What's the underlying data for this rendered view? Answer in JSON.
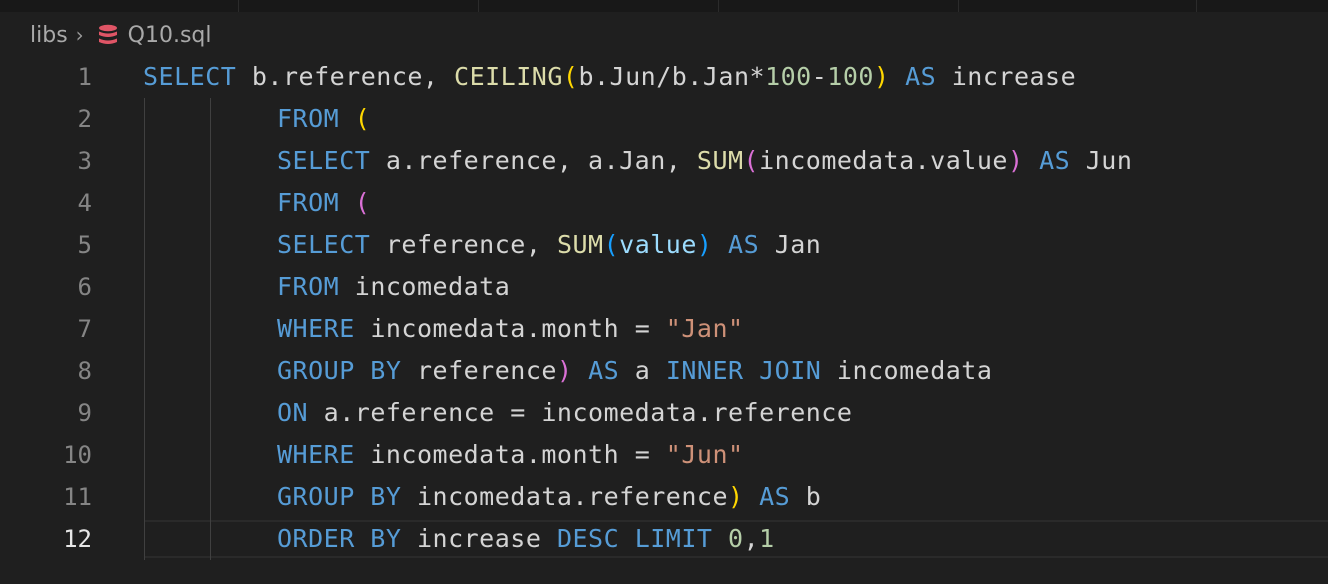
{
  "breadcrumb": {
    "folder": "libs",
    "separator": "›",
    "file_icon": "database-icon",
    "file_name": "Q10.sql"
  },
  "colors": {
    "background": "#1f1f1f",
    "keyword": "#569cd6",
    "function": "#dcdcaa",
    "number": "#b5cea8",
    "string": "#ce9178",
    "bracket_1": "#ffd700",
    "bracket_2": "#da70d6",
    "bracket_3": "#179fff",
    "icon": "#e05566"
  },
  "editor": {
    "current_line": 12,
    "lines": [
      {
        "n": "1",
        "indent": false,
        "tokens": [
          {
            "t": "SELECT",
            "c": "kw"
          },
          {
            "t": " b.reference, ",
            "c": "id"
          },
          {
            "t": "CEILING",
            "c": "fn"
          },
          {
            "t": "(",
            "c": "p1"
          },
          {
            "t": "b.Jun/b.Jan*",
            "c": "id"
          },
          {
            "t": "100",
            "c": "num"
          },
          {
            "t": "-",
            "c": "id"
          },
          {
            "t": "100",
            "c": "num"
          },
          {
            "t": ")",
            "c": "p1"
          },
          {
            "t": " ",
            "c": "id"
          },
          {
            "t": "AS",
            "c": "kw"
          },
          {
            "t": " increase",
            "c": "id"
          }
        ]
      },
      {
        "n": "2",
        "indent": true,
        "tokens": [
          {
            "t": "FROM",
            "c": "kw"
          },
          {
            "t": " ",
            "c": "id"
          },
          {
            "t": "(",
            "c": "p1"
          }
        ]
      },
      {
        "n": "3",
        "indent": true,
        "tokens": [
          {
            "t": "SELECT",
            "c": "kw"
          },
          {
            "t": " a.reference, a.Jan, ",
            "c": "id"
          },
          {
            "t": "SUM",
            "c": "fn"
          },
          {
            "t": "(",
            "c": "p2"
          },
          {
            "t": "incomedata.value",
            "c": "id"
          },
          {
            "t": ")",
            "c": "p2"
          },
          {
            "t": " ",
            "c": "id"
          },
          {
            "t": "AS",
            "c": "kw"
          },
          {
            "t": " Jun",
            "c": "id"
          }
        ]
      },
      {
        "n": "4",
        "indent": true,
        "tokens": [
          {
            "t": "FROM",
            "c": "kw"
          },
          {
            "t": " ",
            "c": "id"
          },
          {
            "t": "(",
            "c": "p2"
          }
        ]
      },
      {
        "n": "5",
        "indent": true,
        "tokens": [
          {
            "t": "SELECT",
            "c": "kw"
          },
          {
            "t": " reference, ",
            "c": "id"
          },
          {
            "t": "SUM",
            "c": "fn"
          },
          {
            "t": "(",
            "c": "p3"
          },
          {
            "t": "value",
            "c": "col"
          },
          {
            "t": ")",
            "c": "p3"
          },
          {
            "t": " ",
            "c": "id"
          },
          {
            "t": "AS",
            "c": "kw"
          },
          {
            "t": " Jan",
            "c": "id"
          }
        ]
      },
      {
        "n": "6",
        "indent": true,
        "tokens": [
          {
            "t": "FROM",
            "c": "kw"
          },
          {
            "t": " incomedata",
            "c": "id"
          }
        ]
      },
      {
        "n": "7",
        "indent": true,
        "tokens": [
          {
            "t": "WHERE",
            "c": "kw"
          },
          {
            "t": " incomedata.month = ",
            "c": "id"
          },
          {
            "t": "\"Jan\"",
            "c": "str"
          }
        ]
      },
      {
        "n": "8",
        "indent": true,
        "tokens": [
          {
            "t": "GROUP BY",
            "c": "kw"
          },
          {
            "t": " reference",
            "c": "id"
          },
          {
            "t": ")",
            "c": "p2"
          },
          {
            "t": " ",
            "c": "id"
          },
          {
            "t": "AS",
            "c": "kw"
          },
          {
            "t": " a ",
            "c": "id"
          },
          {
            "t": "INNER JOIN",
            "c": "kw"
          },
          {
            "t": " incomedata",
            "c": "id"
          }
        ]
      },
      {
        "n": "9",
        "indent": true,
        "tokens": [
          {
            "t": "ON",
            "c": "kw"
          },
          {
            "t": " a.reference = incomedata.reference",
            "c": "id"
          }
        ]
      },
      {
        "n": "10",
        "indent": true,
        "tokens": [
          {
            "t": "WHERE",
            "c": "kw"
          },
          {
            "t": " incomedata.month = ",
            "c": "id"
          },
          {
            "t": "\"Jun\"",
            "c": "str"
          }
        ]
      },
      {
        "n": "11",
        "indent": true,
        "tokens": [
          {
            "t": "GROUP BY",
            "c": "kw"
          },
          {
            "t": " incomedata.reference",
            "c": "id"
          },
          {
            "t": ")",
            "c": "p1"
          },
          {
            "t": " ",
            "c": "id"
          },
          {
            "t": "AS",
            "c": "kw"
          },
          {
            "t": " b",
            "c": "id"
          }
        ]
      },
      {
        "n": "12",
        "indent": true,
        "tokens": [
          {
            "t": "ORDER BY",
            "c": "kw"
          },
          {
            "t": " increase ",
            "c": "id"
          },
          {
            "t": "DESC LIMIT",
            "c": "kw"
          },
          {
            "t": " ",
            "c": "id"
          },
          {
            "t": "0",
            "c": "num"
          },
          {
            "t": ",",
            "c": "id"
          },
          {
            "t": "1",
            "c": "num"
          }
        ]
      }
    ]
  }
}
